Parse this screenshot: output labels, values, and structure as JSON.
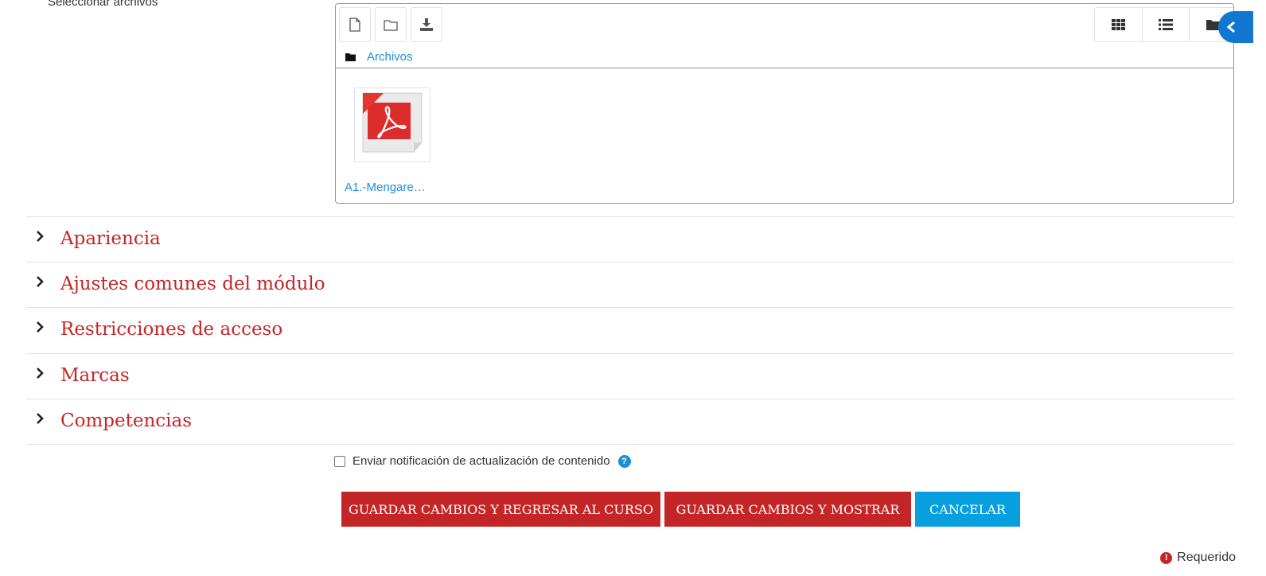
{
  "form": {
    "files_label": "Seleccionar archivos"
  },
  "filemanager": {
    "toolbar": {
      "add_file_icon": "file-icon",
      "create_folder_icon": "folder-icon",
      "download_icon": "download-icon",
      "view_icons": [
        "grid-icon",
        "list-icon",
        "folder-tree-icon"
      ]
    },
    "path_label": "Archivos",
    "files": [
      {
        "name": "A1.-Mengare…",
        "type": "pdf"
      }
    ]
  },
  "sections": [
    {
      "title": "Apariencia"
    },
    {
      "title": "Ajustes comunes del módulo"
    },
    {
      "title": "Restricciones de acceso"
    },
    {
      "title": "Marcas"
    },
    {
      "title": "Competencias"
    }
  ],
  "notification": {
    "label": "Enviar notificación de actualización de contenido",
    "checked": false,
    "help_glyph": "?"
  },
  "buttons": {
    "save_return": "GUARDAR CAMBIOS Y REGRESAR AL CURSO",
    "save_display": "GUARDAR CAMBIOS Y MOSTRAR",
    "cancel": "CANCELAR"
  },
  "required": {
    "glyph": "!",
    "label": "Requerido"
  },
  "colors": {
    "accent_red": "#c42627",
    "accent_blue": "#089fde",
    "link_blue": "#1a8fd6",
    "drawer_blue": "#1177d1"
  }
}
